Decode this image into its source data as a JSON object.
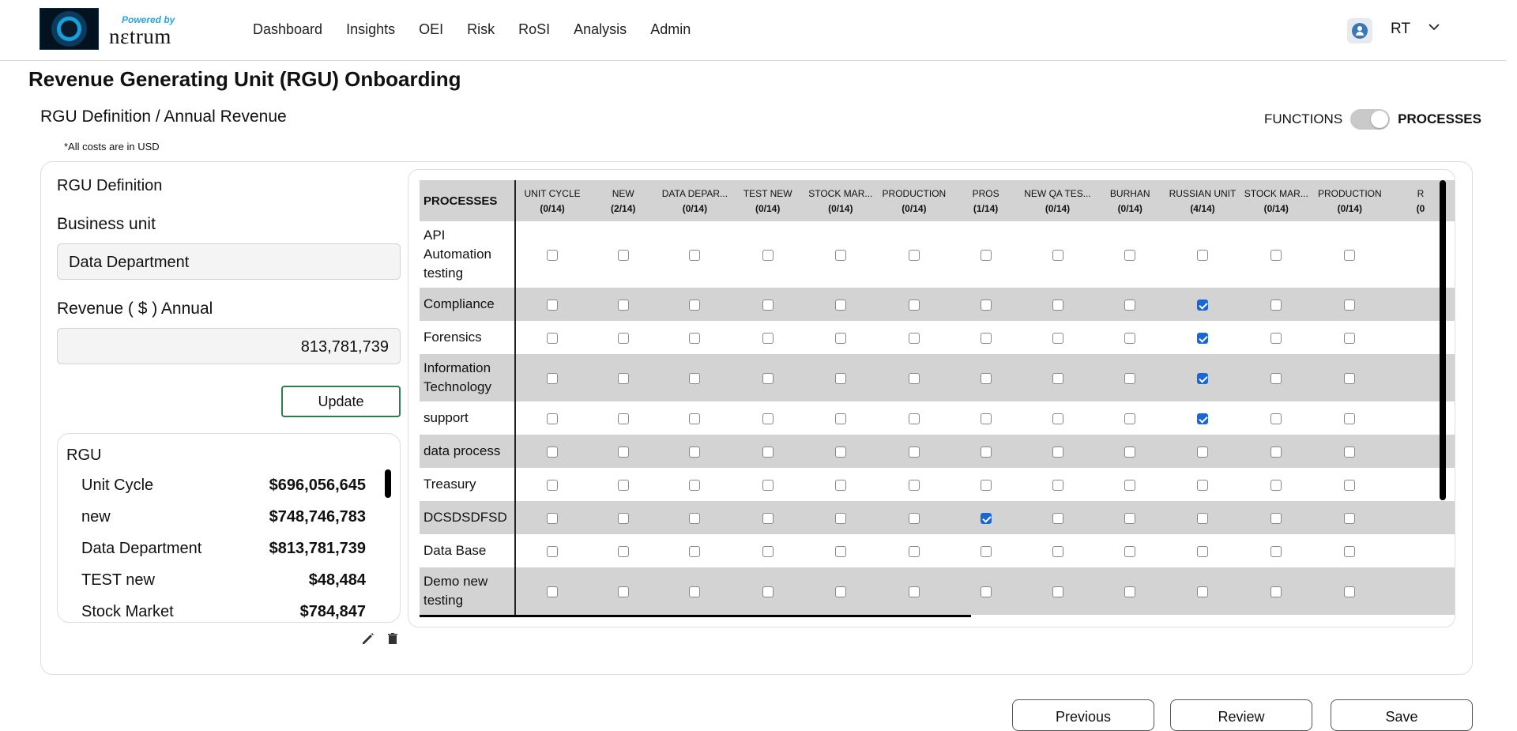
{
  "header": {
    "powered_by": "Powered by",
    "brand": "nεtrum",
    "nav": [
      "Dashboard",
      "Insights",
      "OEI",
      "Risk",
      "RoSI",
      "Analysis",
      "Admin"
    ],
    "user_initials": "RT"
  },
  "page_title": "Revenue Generating Unit (RGU) Onboarding",
  "section_title": "RGU Definition / Annual Revenue",
  "toggle": {
    "left_label": "FUNCTIONS",
    "right_label": "PROCESSES",
    "selected": "PROCESSES"
  },
  "note": "*All costs are in USD",
  "definition": {
    "title": "RGU Definition",
    "business_unit_label": "Business unit",
    "business_unit_value": "Data Department",
    "revenue_label": "Revenue ( $ ) Annual",
    "revenue_value": "813,781,739",
    "update_label": "Update"
  },
  "rgu_list": {
    "title": "RGU",
    "items": [
      {
        "name": "Unit Cycle",
        "value": "$696,056,645"
      },
      {
        "name": "new",
        "value": "$748,746,783"
      },
      {
        "name": "Data Department",
        "value": "$813,781,739"
      },
      {
        "name": "TEST new",
        "value": "$48,484"
      },
      {
        "name": "Stock Market",
        "value": "$784,847"
      }
    ]
  },
  "grid": {
    "header_label": "PROCESSES",
    "columns": [
      {
        "name": "UNIT CYCLE",
        "count": "(0/14)"
      },
      {
        "name": "NEW",
        "count": "(2/14)"
      },
      {
        "name": "DATA DEPAR...",
        "count": "(0/14)"
      },
      {
        "name": "TEST NEW",
        "count": "(0/14)"
      },
      {
        "name": "STOCK MAR...",
        "count": "(0/14)"
      },
      {
        "name": "PRODUCTION",
        "count": "(0/14)"
      },
      {
        "name": "PROS",
        "count": "(1/14)"
      },
      {
        "name": "NEW QA TES...",
        "count": "(0/14)"
      },
      {
        "name": "BURHAN",
        "count": "(0/14)"
      },
      {
        "name": "RUSSIAN UNIT",
        "count": "(4/14)"
      },
      {
        "name": "STOCK MAR...",
        "count": "(0/14)"
      },
      {
        "name": "PRODUCTION",
        "count": "(0/14)"
      },
      {
        "name": "R",
        "count": "(0"
      }
    ],
    "rows": [
      {
        "label": "API Automation testing",
        "checked": []
      },
      {
        "label": "Compliance",
        "checked": [
          9
        ]
      },
      {
        "label": "Forensics",
        "checked": [
          9
        ]
      },
      {
        "label": "Information Technology",
        "checked": [
          9
        ]
      },
      {
        "label": "support",
        "checked": [
          9
        ]
      },
      {
        "label": "data process",
        "checked": []
      },
      {
        "label": "Treasury",
        "checked": []
      },
      {
        "label": "DCSDSDFSD",
        "checked": [
          6
        ]
      },
      {
        "label": "Data Base",
        "checked": []
      },
      {
        "label": "Demo new testing",
        "checked": []
      }
    ]
  },
  "footer_buttons": [
    "Previous",
    "Review",
    "Save"
  ]
}
